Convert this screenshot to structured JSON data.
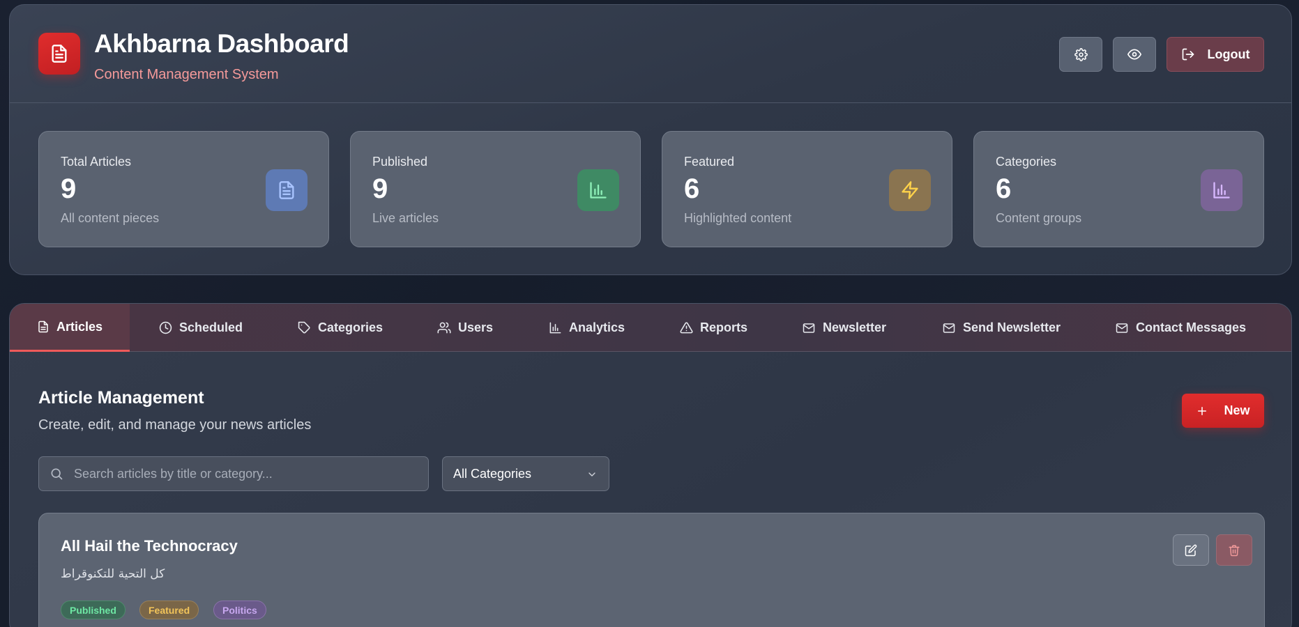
{
  "header": {
    "title": "Akhbarna Dashboard",
    "subtitle": "Content Management System",
    "logout_label": "Logout",
    "icons": {
      "logo": "document-icon",
      "settings": "gear-icon",
      "preview": "eye-icon",
      "logout": "logout-icon"
    }
  },
  "stats": [
    {
      "label": "Total Articles",
      "value": "9",
      "desc": "All content pieces",
      "icon": "document-icon",
      "color": "#5e7ab4"
    },
    {
      "label": "Published",
      "value": "9",
      "desc": "Live articles",
      "icon": "bar-chart-icon",
      "color": "#3f8a64"
    },
    {
      "label": "Featured",
      "value": "6",
      "desc": "Highlighted content",
      "icon": "lightning-icon",
      "color": "#8a7450"
    },
    {
      "label": "Categories",
      "value": "6",
      "desc": "Content groups",
      "icon": "bar-chart-icon",
      "color": "#7a6496"
    }
  ],
  "tabs": [
    {
      "label": "Articles",
      "icon": "document-icon",
      "active": true
    },
    {
      "label": "Scheduled",
      "icon": "clock-icon"
    },
    {
      "label": "Categories",
      "icon": "tag-icon"
    },
    {
      "label": "Users",
      "icon": "users-icon"
    },
    {
      "label": "Analytics",
      "icon": "bar-chart-icon"
    },
    {
      "label": "Reports",
      "icon": "warning-icon"
    },
    {
      "label": "Newsletter",
      "icon": "mail-icon"
    },
    {
      "label": "Send Newsletter",
      "icon": "mail-icon"
    },
    {
      "label": "Contact Messages",
      "icon": "mail-icon"
    }
  ],
  "main": {
    "title": "Article Management",
    "subtitle": "Create, edit, and manage your news articles",
    "new_label": "New",
    "search_placeholder": "Search articles by title or category...",
    "category_filter": "All Categories"
  },
  "articles": [
    {
      "title": "All Hail the Technocracy",
      "title_ar": "كل التحية للتكنوقراط",
      "badges": [
        {
          "label": "Published",
          "text_color": "#6ee7a4",
          "bg": "#3d6a58"
        },
        {
          "label": "Featured",
          "text_color": "#f2c45a",
          "bg": "#7a6648"
        },
        {
          "label": "Politics",
          "text_color": "#c8a8f0",
          "bg": "#6a5a8a"
        }
      ]
    }
  ],
  "colors": {
    "accent": "#dc2626",
    "tab_active_underline": "#ef5a5a"
  }
}
